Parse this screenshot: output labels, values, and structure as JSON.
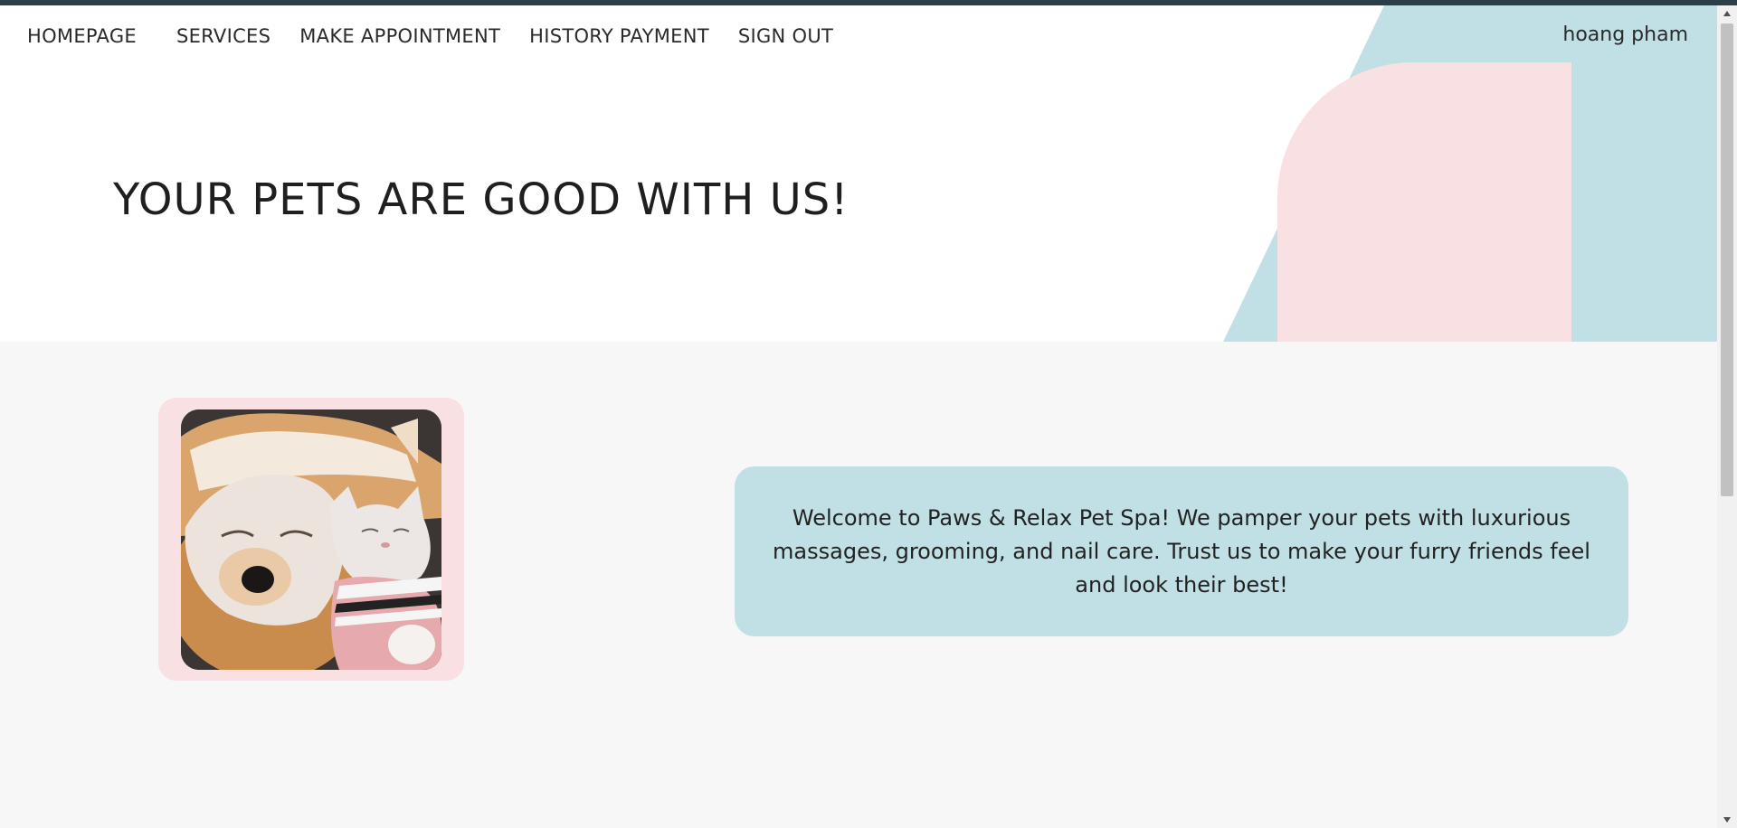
{
  "nav": {
    "items": [
      {
        "label": "HOMEPAGE"
      },
      {
        "label": "SERVICES"
      },
      {
        "label": "MAKE APPOINTMENT"
      },
      {
        "label": "HISTORY PAYMENT"
      },
      {
        "label": "SIGN OUT"
      }
    ],
    "user_name": "hoang pham"
  },
  "hero": {
    "title": "YOUR PETS ARE GOOD WITH US!"
  },
  "about": {
    "welcome_text": "Welcome to Paws & Relax Pet Spa! We pamper your pets with luxurious massages, grooming, and nail care. Trust us to make your furry friends feel and look their best!",
    "image_icon": "pets-face-mask-photo"
  },
  "colors": {
    "topbar": "#2c3e4a",
    "accent_blue": "#c1e0e5",
    "accent_pink": "#f9e0e3",
    "section_bg": "#f7f7f7"
  }
}
